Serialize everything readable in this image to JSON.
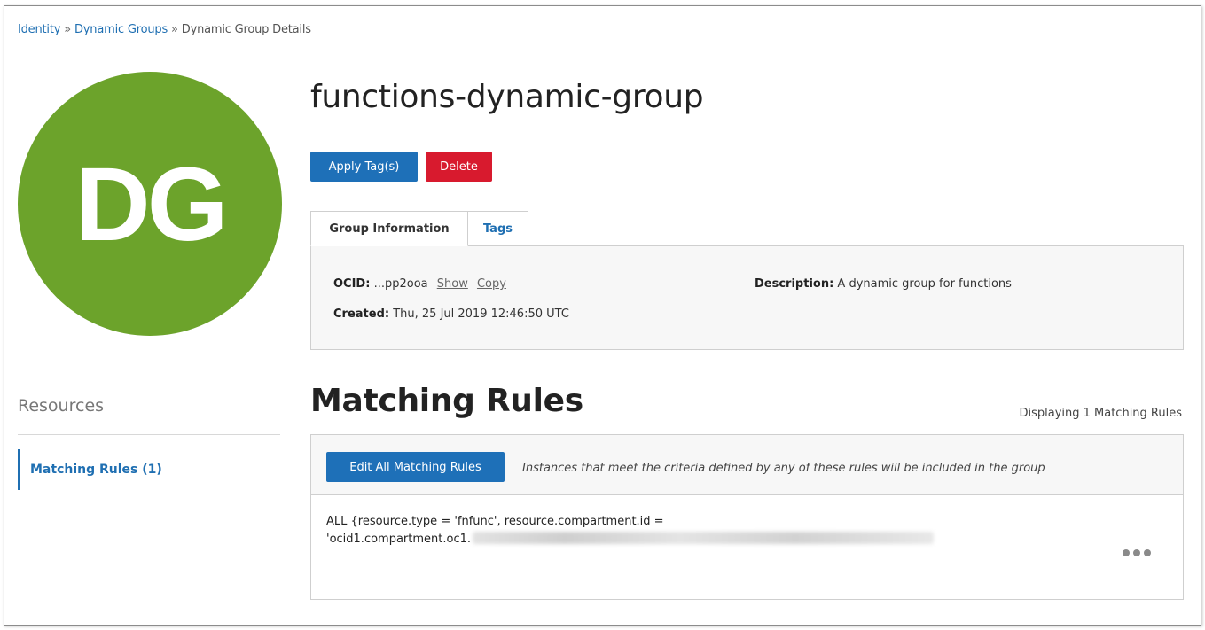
{
  "breadcrumb": {
    "items": [
      "Identity",
      "Dynamic Groups",
      "Dynamic Group Details"
    ],
    "separator": "»"
  },
  "avatar": {
    "initials": "DG",
    "color": "#6ca32b"
  },
  "page": {
    "title": "functions-dynamic-group"
  },
  "actions": {
    "apply_tags": "Apply Tag(s)",
    "delete": "Delete"
  },
  "tabs": [
    {
      "label": "Group Information",
      "active": true
    },
    {
      "label": "Tags",
      "active": false
    }
  ],
  "group_info": {
    "ocid_label": "OCID:",
    "ocid_value": "...pp2ooa",
    "show_link": "Show",
    "copy_link": "Copy",
    "created_label": "Created:",
    "created_value": "Thu, 25 Jul 2019 12:46:50 UTC",
    "description_label": "Description:",
    "description_value": "A dynamic group for functions"
  },
  "resources": {
    "title": "Resources",
    "items": [
      {
        "label": "Matching Rules (1)",
        "active": true
      }
    ]
  },
  "matching_rules": {
    "title": "Matching Rules",
    "count_text": "Displaying 1 Matching Rules",
    "edit_button": "Edit All Matching Rules",
    "hint": "Instances that meet the criteria defined by any of these rules will be included in the group",
    "rules": [
      {
        "line1": "ALL {resource.type = 'fnfunc', resource.compartment.id =",
        "line2": "'ocid1.compartment.oc1."
      }
    ]
  },
  "colors": {
    "link_blue": "#1f6fb2",
    "primary_button": "#1e70b8",
    "danger_button": "#d81a2e"
  },
  "icons": {
    "row_actions": "more-horizontal-icon"
  }
}
